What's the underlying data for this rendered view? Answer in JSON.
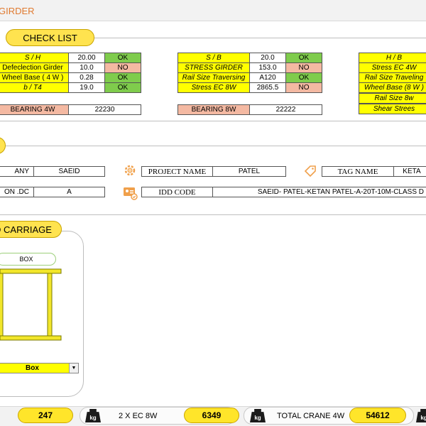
{
  "header": {
    "title": "GIRDER"
  },
  "checklist": {
    "title": "CHECK LIST",
    "table1": [
      {
        "label": "S / H",
        "value": "20.00",
        "status": "OK"
      },
      {
        "label": "Defeclection Girder",
        "value": "10.0",
        "status": "NO"
      },
      {
        "label": "Wheel Base ( 4 W )",
        "value": "0.28",
        "status": "OK"
      },
      {
        "label": "b / T4",
        "value": "19.0",
        "status": "OK"
      }
    ],
    "table2": [
      {
        "label": "S / B",
        "value": "20.0",
        "status": "OK"
      },
      {
        "label": "STRESS GIRDER",
        "value": "153.0",
        "status": "NO"
      },
      {
        "label": "Rail Size Traversing",
        "value": "A120",
        "status": "OK"
      },
      {
        "label": "Stress EC   8W",
        "value": "2865.5",
        "status": "NO"
      }
    ],
    "table3": [
      "H / B",
      "Stress EC   4W",
      "Rail Size Traveling",
      "Wheel Base (8 W )",
      "Rail Size 8w",
      "Shear Strees"
    ],
    "bearing4w": {
      "label": "BEARING 4W",
      "value": "22230"
    },
    "bearing8w": {
      "label": "BEARING 8W",
      "value": "22222"
    }
  },
  "info": {
    "company_label": "ANY",
    "company_value": "SAEID",
    "project_label": "PROJECT NAME",
    "project_value": "PATEL",
    "tag_label": "TAG NAME",
    "tag_value": "KETA",
    "dc_label": "ON .DC",
    "dc_value": "A",
    "idd_label": "IDD CODE",
    "idd_value": "SAEID- PATEL-KETAN PATEL-A-20T-10M-CLASS D"
  },
  "carriage": {
    "title": "D CARRIAGE",
    "box_label": "BOX",
    "dropdown_value": "Box"
  },
  "bottom": {
    "value1": "247",
    "label2": "2 X EC 8W",
    "value2": "6349",
    "label3": "TOTAL CRANE 4W",
    "value3": "54612",
    "kg": "kg"
  },
  "colors": {
    "accent_yellow": "#ffff00",
    "ok_green": "#7fcc4c",
    "no_salmon": "#f4b9a2",
    "pill": "#ffe34f"
  }
}
